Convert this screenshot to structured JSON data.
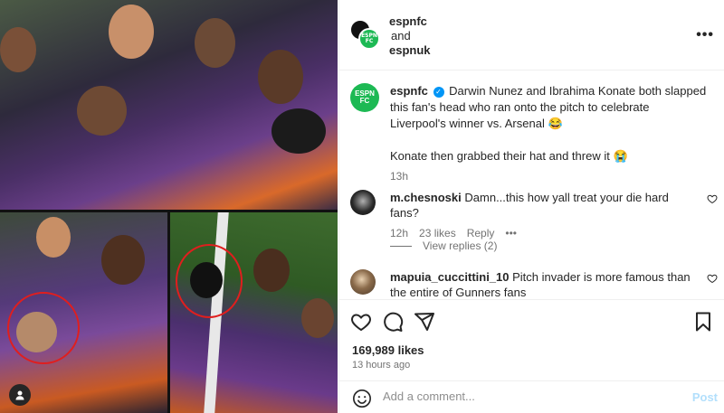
{
  "header": {
    "user1": "espnfc",
    "and_text": "and",
    "user2": "espnuk",
    "badge_text": "ESPN FC"
  },
  "caption": {
    "username": "espnfc",
    "line1": "Darwin Nunez and Ibrahima Konate both slapped this fan's head who ran onto the pitch to celebrate Liverpool's winner vs. Arsenal 😂",
    "line2": "Konate then grabbed their hat and threw it 😭",
    "time": "13h"
  },
  "comments": [
    {
      "username": "m.chesnoski",
      "text": "Damn...this how yall treat your die hard fans?",
      "time": "12h",
      "likes": "23 likes",
      "reply": "Reply",
      "more": "•••"
    },
    {
      "username": "mapuia_cuccittini_10",
      "text": "Pitch invader is more famous than the entire of Gunners fans"
    }
  ],
  "view_replies": "View replies (2)",
  "likes_count": "169,989 likes",
  "post_time": "13 hours ago",
  "add_comment_placeholder": "Add a comment...",
  "post_label": "Post",
  "more_menu": "•••",
  "colors": {
    "accent": "#0095f6",
    "espn_green": "#1db954",
    "post_disabled": "#b2dffc",
    "mark_red": "#e01e1e"
  }
}
